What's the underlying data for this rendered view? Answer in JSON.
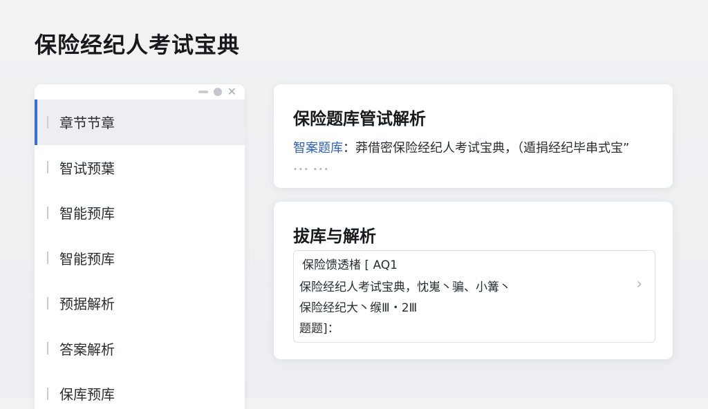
{
  "page": {
    "title": "保险经纪人考试宝典"
  },
  "sidebar": {
    "items": [
      {
        "label": "章节节章",
        "active": true
      },
      {
        "label": "智试预葉",
        "active": false
      },
      {
        "label": "智能预库",
        "active": false
      },
      {
        "label": "智能预库",
        "active": false
      },
      {
        "label": "预据解析",
        "active": false
      },
      {
        "label": "答案解析",
        "active": false
      },
      {
        "label": "保库预库",
        "active": false
      }
    ]
  },
  "card1": {
    "title": "保险题库管试解析",
    "highlight": "智案题库",
    "text": "：莽借密保险经纪人考试宝典，（遁捐经纪毕串式宝”",
    "dots": "••• •••"
  },
  "card2": {
    "title": "拔库与解析",
    "lines": [
      "保险馈透楮 [ AQ1",
      "保险经纪人考试宝典，忱嵬丶骗、小篝丶",
      "保险经纪大丶缑Ⅲ・2Ⅲ",
      "题题]："
    ]
  },
  "icons": {
    "minimize": "minimize-icon",
    "circle": "circle-icon",
    "close": "close-icon",
    "chevron": "chevron-right-icon"
  },
  "colors": {
    "accent": "#3a6fd8",
    "highlight": "#2f5fb8",
    "background": "#eceef1"
  }
}
